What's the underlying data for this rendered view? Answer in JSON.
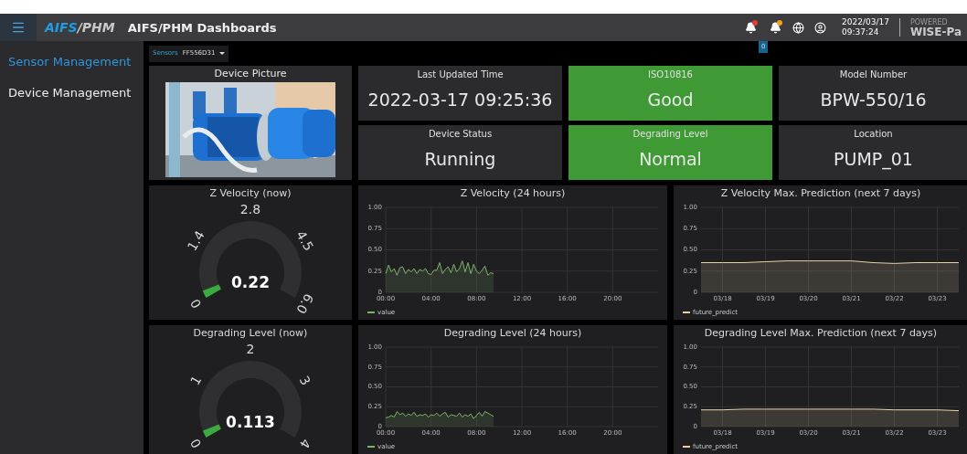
{
  "header": {
    "logo": {
      "accent": "AIFS",
      "rest": "/PHM"
    },
    "title": "AIFS/PHM Dashboards",
    "notifications": [
      {
        "color": "#e03a3a"
      },
      {
        "color": "#f0a020"
      }
    ],
    "badge": "0",
    "date": "2022/03/17",
    "time": "09:37:24",
    "powered_by": "POWERED",
    "brand": "WISE-Pa"
  },
  "sidebar": {
    "items": [
      {
        "label": "Sensor Management",
        "selected": true
      },
      {
        "label": "Device Management",
        "selected": false
      }
    ]
  },
  "sensor_bar": {
    "label": "Sensors",
    "value": "FF556D31"
  },
  "device_picture": {
    "title": "Device Picture",
    "kind": "picture"
  },
  "stats": [
    {
      "label": "Last Updated Time",
      "value": "2022-03-17 09:25:36",
      "highlight": false
    },
    {
      "label": "ISO10816",
      "value": "Good",
      "highlight": true
    },
    {
      "label": "Model Number",
      "value": "BPW-550/16",
      "highlight": false
    },
    {
      "label": "Device Status",
      "value": "Running",
      "highlight": false
    },
    {
      "label": "Degrading Level",
      "value": "Normal",
      "highlight": true
    },
    {
      "label": "Location",
      "value": "PUMP_01",
      "highlight": false
    }
  ],
  "rows": [
    {
      "gauge": {
        "title": "Z Velocity (now)",
        "value": "0.22",
        "ticks": [
          "0",
          "1.4",
          "2.8",
          "4.5",
          "6.0"
        ]
      },
      "history": {
        "title": "Z Velocity (24 hours)",
        "chart_data": {
          "type": "area",
          "grid": true,
          "x": [
            0,
            0.25,
            0.5,
            0.75,
            1,
            1.25,
            1.5,
            1.75,
            2,
            2.25,
            2.5,
            2.75,
            3,
            3.25,
            3.5,
            3.75,
            4,
            4.25,
            4.5,
            4.75,
            5,
            5.25,
            5.5,
            5.75,
            6,
            6.25,
            6.5,
            6.75,
            7,
            7.25,
            7.5,
            7.75,
            8,
            8.25,
            8.5,
            8.75,
            9,
            9.25,
            9.5
          ],
          "series": [
            {
              "name": "value",
              "color": "#7eb26d",
              "values": [
                0.22,
                0.32,
                0.24,
                0.28,
                0.2,
                0.29,
                0.3,
                0.22,
                0.27,
                0.24,
                0.28,
                0.22,
                0.27,
                0.25,
                0.28,
                0.22,
                0.21,
                0.26,
                0.26,
                0.35,
                0.22,
                0.27,
                0.3,
                0.23,
                0.33,
                0.24,
                0.28,
                0.37,
                0.24,
                0.35,
                0.22,
                0.33,
                0.25,
                0.22,
                0.26,
                0.31,
                0.2,
                0.23,
                0.22
              ]
            }
          ],
          "xlim": [
            0,
            24
          ],
          "ylim": [
            0,
            1
          ],
          "xticks": [
            {
              "value": 0,
              "label": "00:00"
            },
            {
              "value": 4,
              "label": "04:00"
            },
            {
              "value": 8,
              "label": "08:00"
            },
            {
              "value": 12,
              "label": "12:00"
            },
            {
              "value": 16,
              "label": "16:00"
            },
            {
              "value": 20,
              "label": "20:00"
            }
          ],
          "yticks": [
            {
              "value": 0,
              "label": "0"
            },
            {
              "value": 0.25,
              "label": "0.25"
            },
            {
              "value": 0.5,
              "label": "0.50"
            },
            {
              "value": 0.75,
              "label": "0.75"
            },
            {
              "value": 1,
              "label": "1.00"
            }
          ]
        }
      },
      "prediction": {
        "title": "Z Velocity Max. Prediction (next 7 days)",
        "chart_data": {
          "type": "area",
          "grid": true,
          "categories": [
            null,
            "03/18",
            null,
            "03/19",
            null,
            "03/20",
            null,
            "03/21",
            null,
            "03/22",
            null,
            "03/23",
            null
          ],
          "series": [
            {
              "name": "future_predict",
              "color": "#e8d2a6",
              "values": [
                0.35,
                0.35,
                0.35,
                0.36,
                0.37,
                0.37,
                0.37,
                0.37,
                0.35,
                0.34,
                0.35,
                0.35,
                0.35
              ]
            }
          ],
          "ylim": [
            0,
            1
          ],
          "yticks": [
            {
              "value": 0,
              "label": "0"
            },
            {
              "value": 0.25,
              "label": "0.25"
            },
            {
              "value": 0.5,
              "label": "0.50"
            },
            {
              "value": 0.75,
              "label": "0.75"
            },
            {
              "value": 1,
              "label": "1.00"
            }
          ]
        }
      }
    },
    {
      "gauge": {
        "title": "Degrading Level (now)",
        "value": "0.113",
        "ticks": [
          "0",
          "1",
          "2",
          "3",
          "4"
        ]
      },
      "history": {
        "title": "Degrading Level (24 hours)",
        "chart_data": {
          "type": "area",
          "grid": true,
          "x": [
            0,
            0.25,
            0.5,
            0.75,
            1,
            1.25,
            1.5,
            1.75,
            2,
            2.25,
            2.5,
            2.75,
            3,
            3.25,
            3.5,
            3.75,
            4,
            4.25,
            4.5,
            4.75,
            5,
            5.25,
            5.5,
            5.75,
            6,
            6.25,
            6.5,
            6.75,
            7,
            7.25,
            7.5,
            7.75,
            8,
            8.25,
            8.5,
            8.75,
            9,
            9.25,
            9.5
          ],
          "series": [
            {
              "name": "value",
              "color": "#7eb26d",
              "values": [
                0.11,
                0.12,
                0.14,
                0.12,
                0.19,
                0.15,
                0.17,
                0.13,
                0.16,
                0.14,
                0.18,
                0.13,
                0.15,
                0.14,
                0.16,
                0.12,
                0.15,
                0.14,
                0.17,
                0.13,
                0.16,
                0.18,
                0.12,
                0.15,
                0.14,
                0.13,
                0.17,
                0.12,
                0.15,
                0.13,
                0.16,
                0.1,
                0.14,
                0.18,
                0.13,
                0.19,
                0.17,
                0.15,
                0.13
              ]
            }
          ],
          "xlim": [
            0,
            24
          ],
          "ylim": [
            0,
            1
          ],
          "xticks": [
            {
              "value": 0,
              "label": "00:00"
            },
            {
              "value": 4,
              "label": "04:00"
            },
            {
              "value": 8,
              "label": "08:00"
            },
            {
              "value": 12,
              "label": "12:00"
            },
            {
              "value": 16,
              "label": "16:00"
            },
            {
              "value": 20,
              "label": "20:00"
            }
          ],
          "yticks": [
            {
              "value": 0,
              "label": "0"
            },
            {
              "value": 0.25,
              "label": "0.25"
            },
            {
              "value": 0.5,
              "label": "0.50"
            },
            {
              "value": 0.75,
              "label": "0.75"
            },
            {
              "value": 1,
              "label": "1.00"
            }
          ]
        }
      },
      "prediction": {
        "title": "Degrading Level Max. Prediction (next 7 days)",
        "chart_data": {
          "type": "area",
          "grid": true,
          "categories": [
            null,
            "03/18",
            null,
            "03/19",
            null,
            "03/20",
            null,
            "03/21",
            null,
            "03/22",
            null,
            "03/23",
            null
          ],
          "series": [
            {
              "name": "future_predict",
              "color": "#e8d2a6",
              "values": [
                0.21,
                0.21,
                0.22,
                0.22,
                0.22,
                0.22,
                0.22,
                0.22,
                0.22,
                0.21,
                0.21,
                0.21,
                0.2
              ]
            }
          ],
          "ylim": [
            0,
            1
          ],
          "yticks": [
            {
              "value": 0,
              "label": "0"
            },
            {
              "value": 0.25,
              "label": "0.25"
            },
            {
              "value": 0.5,
              "label": "0.50"
            },
            {
              "value": 0.75,
              "label": "0.75"
            },
            {
              "value": 1,
              "label": "1.00"
            }
          ]
        }
      }
    }
  ]
}
